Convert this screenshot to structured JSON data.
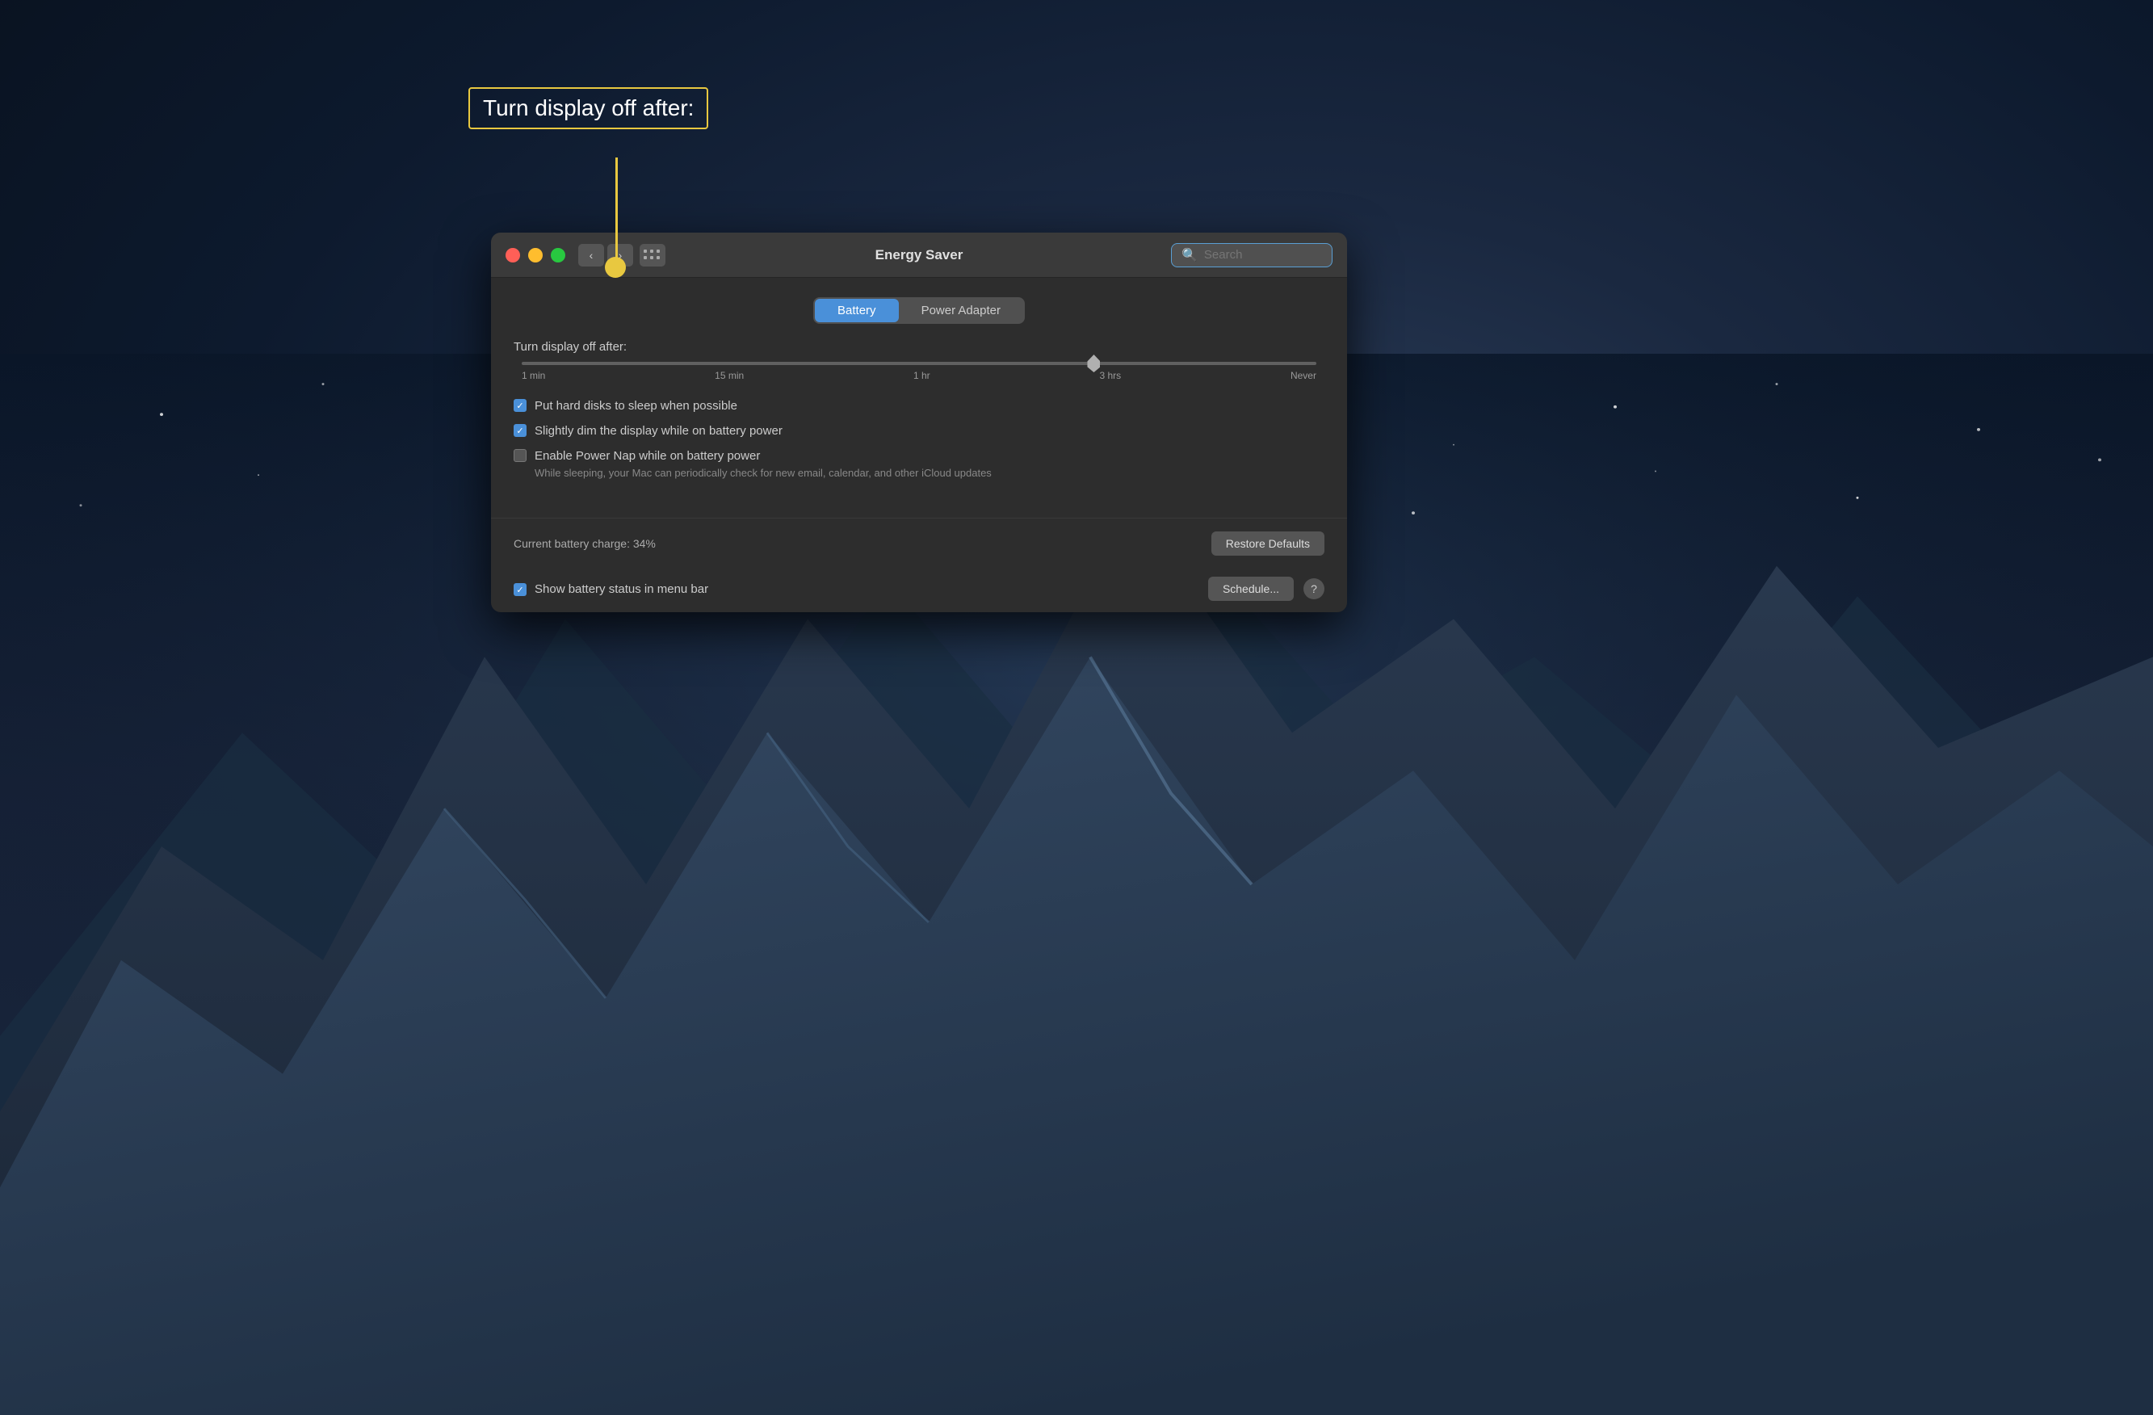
{
  "desktop": {
    "bg_gradient": "radial-gradient dark night sky"
  },
  "callout": {
    "label": "Turn display off after:",
    "border_color": "#e8c840"
  },
  "window": {
    "title": "Energy Saver",
    "traffic_lights": {
      "close": "close-window",
      "minimize": "minimize-window",
      "maximize": "maximize-window"
    },
    "nav": {
      "back_label": "‹",
      "forward_label": "›"
    },
    "search": {
      "placeholder": "Search",
      "value": ""
    },
    "tabs": [
      {
        "label": "Battery",
        "active": true
      },
      {
        "label": "Power Adapter",
        "active": false
      }
    ],
    "slider": {
      "label": "Turn display off after:",
      "ticks": [
        "1 min",
        "15 min",
        "1 hr",
        "3 hrs",
        "Never"
      ],
      "position_percent": 72
    },
    "checkboxes": [
      {
        "label": "Put hard disks to sleep when possible",
        "checked": true,
        "sublabel": ""
      },
      {
        "label": "Slightly dim the display while on battery power",
        "checked": true,
        "sublabel": ""
      },
      {
        "label": "Enable Power Nap while on battery power",
        "checked": false,
        "sublabel": "While sleeping, your Mac can periodically check for new email, calendar, and other iCloud updates"
      }
    ],
    "battery_status": "Current battery charge: 34%",
    "restore_defaults_label": "Restore Defaults",
    "show_battery_label": "Show battery status in menu bar",
    "show_battery_checked": true,
    "schedule_label": "Schedule...",
    "help_label": "?"
  }
}
